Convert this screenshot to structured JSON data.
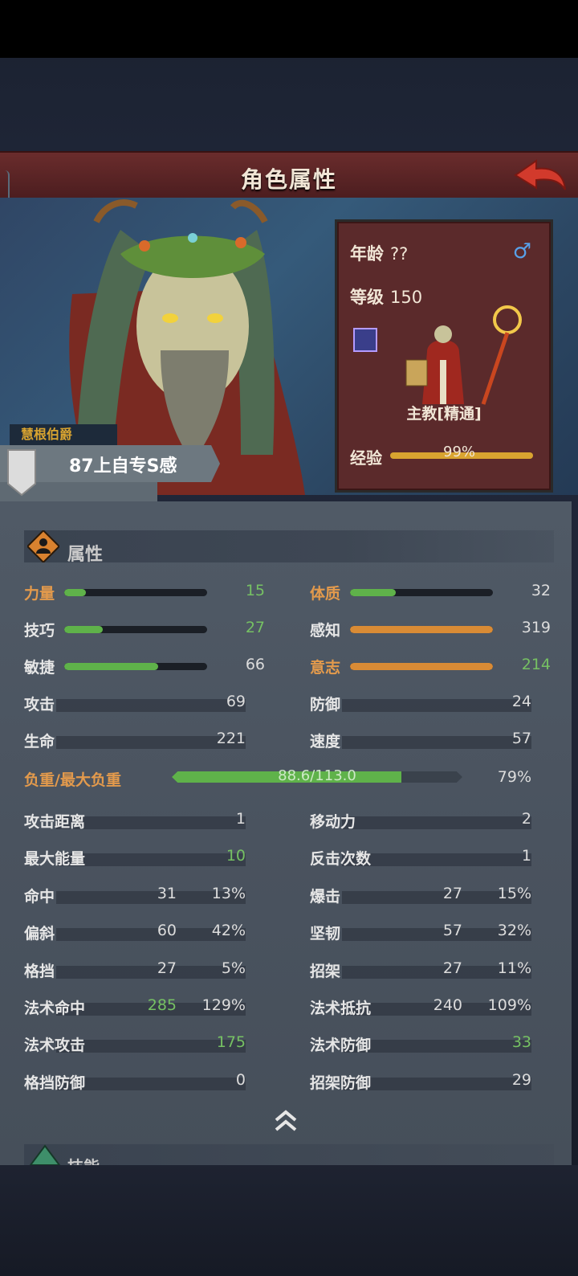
{
  "header": {
    "title": "角色属性",
    "back_icon": "back-arrow-icon"
  },
  "character": {
    "title_tag": "慧根伯爵",
    "name": "87上自专S感",
    "age_label": "年龄",
    "age_value": "??",
    "gender_icon": "male-icon",
    "level_label": "等级",
    "level_value": "150",
    "class_label": "主教[精通]",
    "exp_label": "经验",
    "exp_value": "99%",
    "exp_fraction": 0.99
  },
  "attributes_section": {
    "title": "属性"
  },
  "primary_stats": [
    {
      "label": "力量",
      "value": "15",
      "gold": true,
      "value_green": true,
      "fill": 0.15,
      "color": "#5fb24a"
    },
    {
      "label": "体质",
      "value": "32",
      "gold": true,
      "value_green": false,
      "fill": 0.32,
      "color": "#5fb24a"
    },
    {
      "label": "技巧",
      "value": "27",
      "gold": false,
      "value_green": true,
      "fill": 0.27,
      "color": "#5fb24a"
    },
    {
      "label": "感知",
      "value": "319",
      "gold": false,
      "value_green": false,
      "fill": 1.0,
      "color": "#d98b35"
    },
    {
      "label": "敏捷",
      "value": "66",
      "gold": false,
      "value_green": false,
      "fill": 0.66,
      "color": "#5fb24a"
    },
    {
      "label": "意志",
      "value": "214",
      "gold": true,
      "value_green": true,
      "fill": 1.0,
      "color": "#d98b35"
    }
  ],
  "basic_stats": [
    {
      "label": "攻击",
      "value": "69"
    },
    {
      "label": "防御",
      "value": "24"
    },
    {
      "label": "生命",
      "value": "221"
    },
    {
      "label": "速度",
      "value": "57"
    }
  ],
  "load": {
    "label": "负重/最大负重",
    "text": "88.6/113.0",
    "percent": "79%",
    "fraction": 0.79
  },
  "secondary_stats": [
    {
      "label": "攻击距离",
      "value": "1"
    },
    {
      "label": "移动力",
      "value": "2"
    },
    {
      "label": "最大能量",
      "value": "10",
      "green": true
    },
    {
      "label": "反击次数",
      "value": "1"
    },
    {
      "label": "命中",
      "value": "31",
      "pct": "13%"
    },
    {
      "label": "爆击",
      "value": "27",
      "pct": "15%"
    },
    {
      "label": "偏斜",
      "value": "60",
      "pct": "42%"
    },
    {
      "label": "坚韧",
      "value": "57",
      "pct": "32%"
    },
    {
      "label": "格挡",
      "value": "27",
      "pct": "5%"
    },
    {
      "label": "招架",
      "value": "27",
      "pct": "11%"
    },
    {
      "label": "法术命中",
      "value": "285",
      "pct": "129%",
      "green": true
    },
    {
      "label": "法术抵抗",
      "value": "240",
      "pct": "109%"
    },
    {
      "label": "法术攻击",
      "value": "175",
      "green": true
    },
    {
      "label": "法术防御",
      "value": "33",
      "green": true
    },
    {
      "label": "格挡防御",
      "value": "0"
    },
    {
      "label": "招架防御",
      "value": "29"
    }
  ],
  "skills_section": {
    "title": "技能"
  }
}
